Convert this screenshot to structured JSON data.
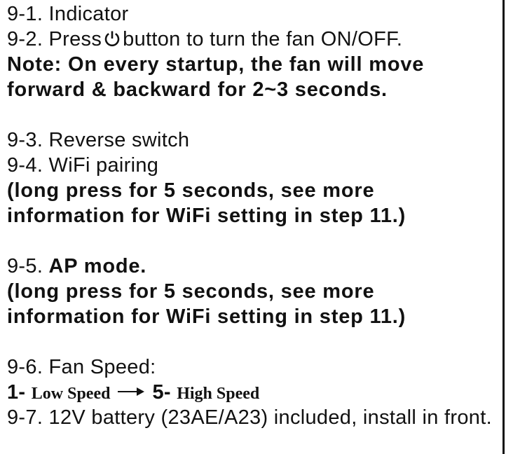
{
  "items": {
    "i1": {
      "num": "9-1.",
      "text": "Indicator"
    },
    "i2": {
      "num": "9-2.",
      "pre": "Press",
      "icon": "power-icon",
      "post": "button to turn the fan ON/OFF."
    },
    "note_line1": "Note: On every startup, the fan will move",
    "note_line2": "forward & backward for 2~3 seconds.",
    "i3": {
      "num": "9-3.",
      "text": "Reverse switch"
    },
    "i4": {
      "num": "9-4.",
      "text": "WiFi pairing"
    },
    "i4_detail_line1": "(long press for 5 seconds, see more",
    "i4_detail_line2": "information for WiFi setting in step 11.)",
    "i5": {
      "num": "9-5.",
      "text": "AP mode."
    },
    "i5_detail_line1": "(long press for 5 seconds, see more",
    "i5_detail_line2": "information for WiFi setting in step 11.)",
    "i6": {
      "num": "9-6.",
      "text": "Fan Speed:"
    },
    "speed": {
      "low_num": "1-",
      "low_label": "Low Speed",
      "arrow_icon": "arrow-right-icon",
      "high_num": "5-",
      "high_label": "High Speed"
    },
    "i7": {
      "num": "9-7.",
      "text": "12V battery (23AE/A23) included, install in front."
    }
  },
  "colors": {
    "text": "#111111",
    "background": "#ffffff"
  }
}
